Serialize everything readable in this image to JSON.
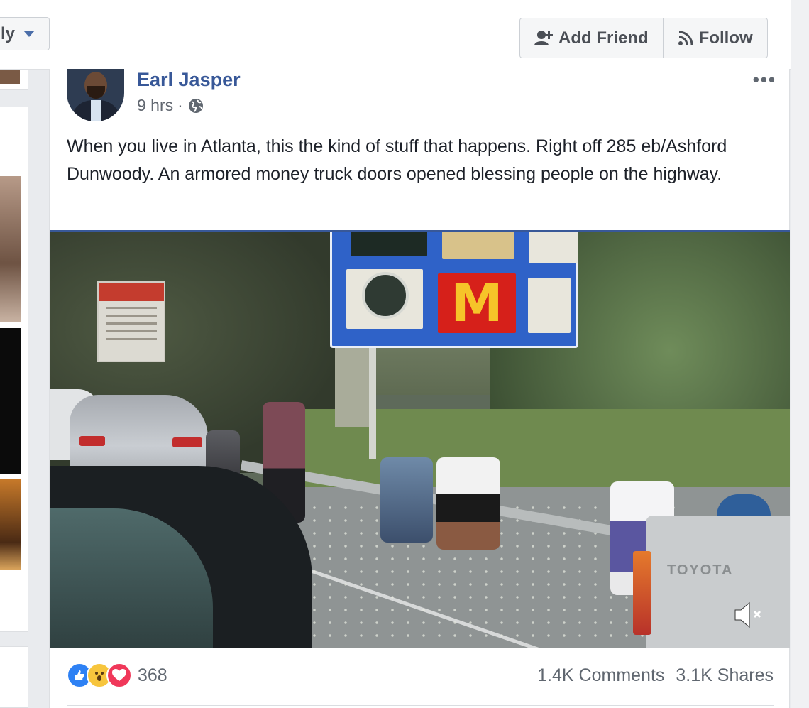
{
  "topbar": {
    "dropdown_label": "ly",
    "add_friend_label": "Add Friend",
    "follow_label": "Follow"
  },
  "post": {
    "author": "Earl Jasper",
    "time": "9 hrs",
    "separator": "·",
    "privacy_icon": "globe-icon",
    "more_label": "•••",
    "text": "When you live in Atlanta, this the kind of stuff that happens. Right off 285 eb/Ashford Dunwoody. An armored money truck doors opened blessing people on the highway.",
    "video": {
      "sign_logo": "M",
      "truck_brand": "TOYOTA",
      "mute_icon": "speaker-muted-icon"
    },
    "reactions": {
      "icons": [
        "like-icon",
        "wow-icon",
        "love-icon"
      ],
      "count": "368"
    },
    "comments": "1.4K Comments",
    "shares": "3.1K Shares"
  }
}
